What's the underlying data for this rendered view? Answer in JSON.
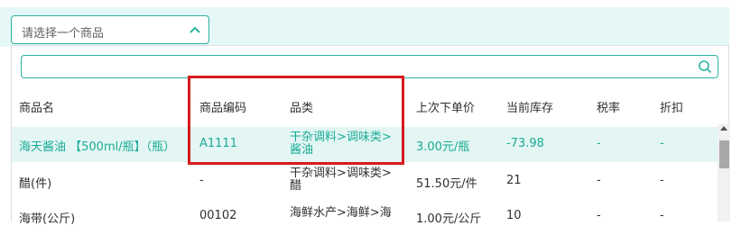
{
  "select": {
    "placeholder": "请选择一个商品"
  },
  "search": {
    "value": ""
  },
  "table": {
    "headers": {
      "name": "商品名",
      "code": "商品编码",
      "category": "品类",
      "last_price": "上次下单价",
      "stock": "当前库存",
      "tax": "税率",
      "discount": "折扣"
    },
    "rows": [
      {
        "name": "海天酱油 【500ml/瓶】（瓶）",
        "code": "A1111",
        "category_l1": "干杂调料>调味类>",
        "category_l2": "酱油",
        "last_price": "3.00元/瓶",
        "stock": "-73.98",
        "tax": "-",
        "discount": "-"
      },
      {
        "name": "醋(件)",
        "code": "-",
        "category_l1": "干杂调料>调味类>",
        "category_l2": "醋",
        "last_price": "51.50元/件",
        "stock": "21",
        "tax": "-",
        "discount": "-"
      },
      {
        "name": "海带(公斤)",
        "code": "00102",
        "category_l1": "海鲜水产>海鲜>海",
        "category_l2": "",
        "last_price": "1.00元/公斤",
        "stock": "10",
        "tax": "-",
        "discount": "-"
      }
    ]
  },
  "colors": {
    "accent": "#1aab96",
    "highlight_row": "#e3f6f3",
    "annotation": "#d71a1f"
  }
}
